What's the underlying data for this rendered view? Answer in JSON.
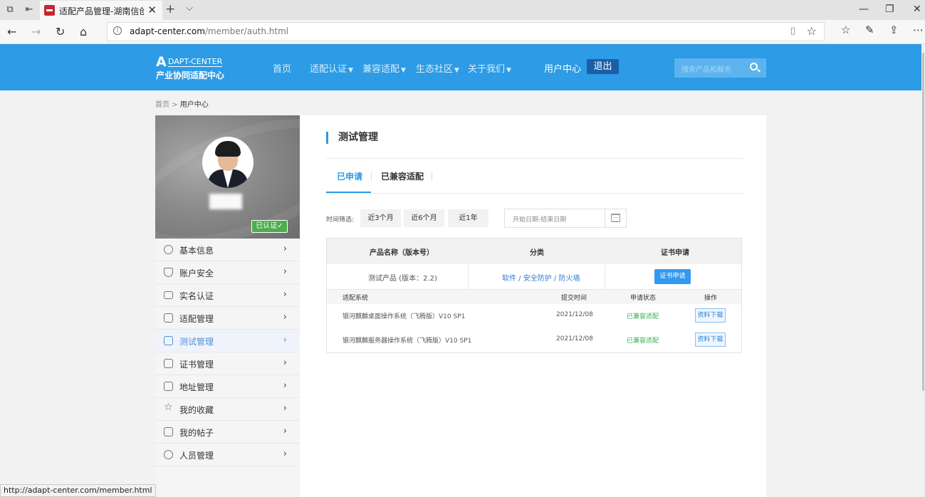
{
  "browser": {
    "tab_title": "适配产品管理-湖南信创",
    "tab_close": "✕",
    "new_tab": "+",
    "tab_list": "⌵",
    "url_host": "adapt-center.com",
    "url_path": "/member/auth.html",
    "win_min": "—",
    "win_max": "❐",
    "win_close": "✕"
  },
  "header": {
    "logo_letter": "A",
    "logo_top": "DAPT-CENTER",
    "logo_bottom": "产业协同适配中心",
    "menu": {
      "home": "首页",
      "auth": "适配认证",
      "compat": "兼容适配",
      "ecology": "生态社区",
      "about": "关于我们",
      "user_center": "用户中心"
    },
    "logout": "退出",
    "search_placeholder": "搜索产品和服务"
  },
  "breadcrumb": {
    "home": "首页",
    "separator": " > ",
    "current": "用户中心"
  },
  "profile": {
    "verified": "已认证✓"
  },
  "sidebar": {
    "items": [
      {
        "label": "基本信息",
        "icon": "user-icon"
      },
      {
        "label": "账户安全",
        "icon": "shield-icon"
      },
      {
        "label": "实名认证",
        "icon": "id-card-icon"
      },
      {
        "label": "适配管理",
        "icon": "printer-icon"
      },
      {
        "label": "测试管理",
        "icon": "document-icon",
        "active": true
      },
      {
        "label": "证书管理",
        "icon": "certificate-icon"
      },
      {
        "label": "地址管理",
        "icon": "address-icon"
      },
      {
        "label": "我的收藏",
        "icon": "star-icon"
      },
      {
        "label": "我的帖子",
        "icon": "post-icon"
      },
      {
        "label": "人员管理",
        "icon": "people-icon"
      }
    ],
    "arrow": "›"
  },
  "main": {
    "title": "测试管理",
    "tabs": {
      "applied": "已申请",
      "compatible": "已兼容适配"
    },
    "filter": {
      "label": "时间筛选:",
      "btn_3m": "近3个月",
      "btn_6m": "近6个月",
      "btn_1y": "近1年",
      "date_placeholder": "开始日期-结束日期"
    },
    "table": {
      "headers": {
        "product": "产品名称（版本号）",
        "category": "分类",
        "certificate": "证书申请"
      },
      "product": {
        "name": "测试产品 (版本：2.2)",
        "category": "软件 / 安全防护 / 防火墙",
        "apply_button": "证书申请"
      },
      "sub_headers": {
        "system": "适配系统",
        "time": "提交时间",
        "status": "申请状态",
        "action": "操作"
      },
      "rows": [
        {
          "system": "银河麒麟桌面操作系统（飞腾版）V10 SP1",
          "time": "2021/12/08",
          "status": "已兼容适配",
          "action": "资料下载"
        },
        {
          "system": "银河麒麟服务器操作系统（飞腾版）V10 SP1",
          "time": "2021/12/08",
          "status": "已兼容适配",
          "action": "资料下载"
        }
      ]
    }
  },
  "status_bar": {
    "url": "http://adapt-center.com/member.html"
  }
}
